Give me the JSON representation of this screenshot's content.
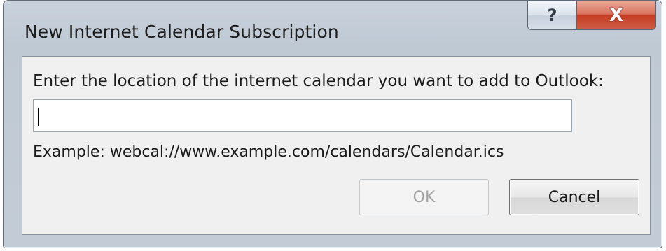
{
  "window": {
    "title": "New Internet Calendar Subscription",
    "help_glyph": "?",
    "close_glyph": "X"
  },
  "form": {
    "prompt": "Enter the location of the internet calendar you want to add to Outlook:",
    "url_value": "",
    "example": "Example: webcal://www.example.com/calendars/Calendar.ics"
  },
  "buttons": {
    "ok_label": "OK",
    "ok_enabled": false,
    "cancel_label": "Cancel"
  },
  "colors": {
    "close_button": "#c43d23",
    "dialog_body": "#f0f0f0",
    "disabled_text": "#a3a3a3"
  }
}
